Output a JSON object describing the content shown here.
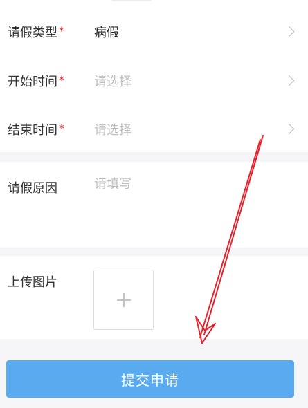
{
  "form": {
    "leave_type": {
      "label": "请假类型",
      "required_mark": "*",
      "value": "病假"
    },
    "start_time": {
      "label": "开始时间",
      "required_mark": "*",
      "placeholder": "请选择"
    },
    "end_time": {
      "label": "结束时间",
      "required_mark": "*",
      "placeholder": "请选择"
    },
    "reason": {
      "label": "请假原因",
      "placeholder": "请填写"
    },
    "upload": {
      "label": "上传图片",
      "icon": "plus-icon"
    },
    "submit_label": "提交申请"
  },
  "colors": {
    "primary_button": "#5aaaf0",
    "required": "#e02020",
    "annotation_arrow": "#e8202a"
  }
}
